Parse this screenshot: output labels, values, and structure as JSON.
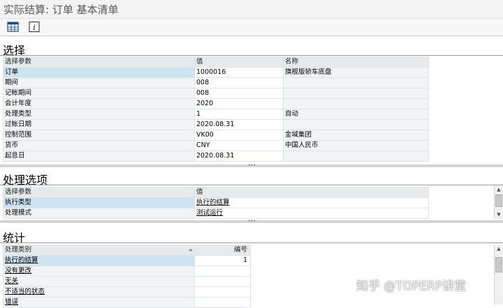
{
  "window": {
    "title": "实际结算: 订单 基本清单"
  },
  "toolbar": {
    "layout_icon": "table-layout-icon",
    "info_icon": "info-icon"
  },
  "selection": {
    "title": "选择",
    "headers": [
      "选择参数",
      "值",
      "名称"
    ],
    "rows": [
      {
        "param": "订单",
        "value": "1000016",
        "name": "旗舰版轿车底盘"
      },
      {
        "param": "期间",
        "value": "008",
        "name": ""
      },
      {
        "param": "记帐期间",
        "value": "008",
        "name": ""
      },
      {
        "param": "会计年度",
        "value": "2020",
        "name": ""
      },
      {
        "param": "处理类型",
        "value": "1",
        "name": "自动"
      },
      {
        "param": "过帐日期",
        "value": "2020.08.31",
        "name": ""
      },
      {
        "param": "控制范围",
        "value": "VK00",
        "name": "金域集团"
      },
      {
        "param": "货币",
        "value": "CNY",
        "name": "中国人民币"
      },
      {
        "param": "起息日",
        "value": "2020.08.31",
        "name": ""
      }
    ]
  },
  "processing": {
    "title": "处理选项",
    "headers": [
      "选择参数",
      "值"
    ],
    "rows": [
      {
        "param": "执行类型",
        "value": "执行的结算"
      },
      {
        "param": "处理模式",
        "value": "测试运行"
      }
    ]
  },
  "statistics": {
    "title": "统计",
    "headers": [
      "处理类别",
      "编号"
    ],
    "rows": [
      {
        "category": "执行的结算",
        "number": "1"
      },
      {
        "category": "没有更改",
        "number": ""
      },
      {
        "category": "无关",
        "number": ""
      },
      {
        "category": "不适当的状态",
        "number": ""
      },
      {
        "category": "错误",
        "number": ""
      }
    ]
  },
  "watermark": "知乎 @TOPERP讲堂"
}
